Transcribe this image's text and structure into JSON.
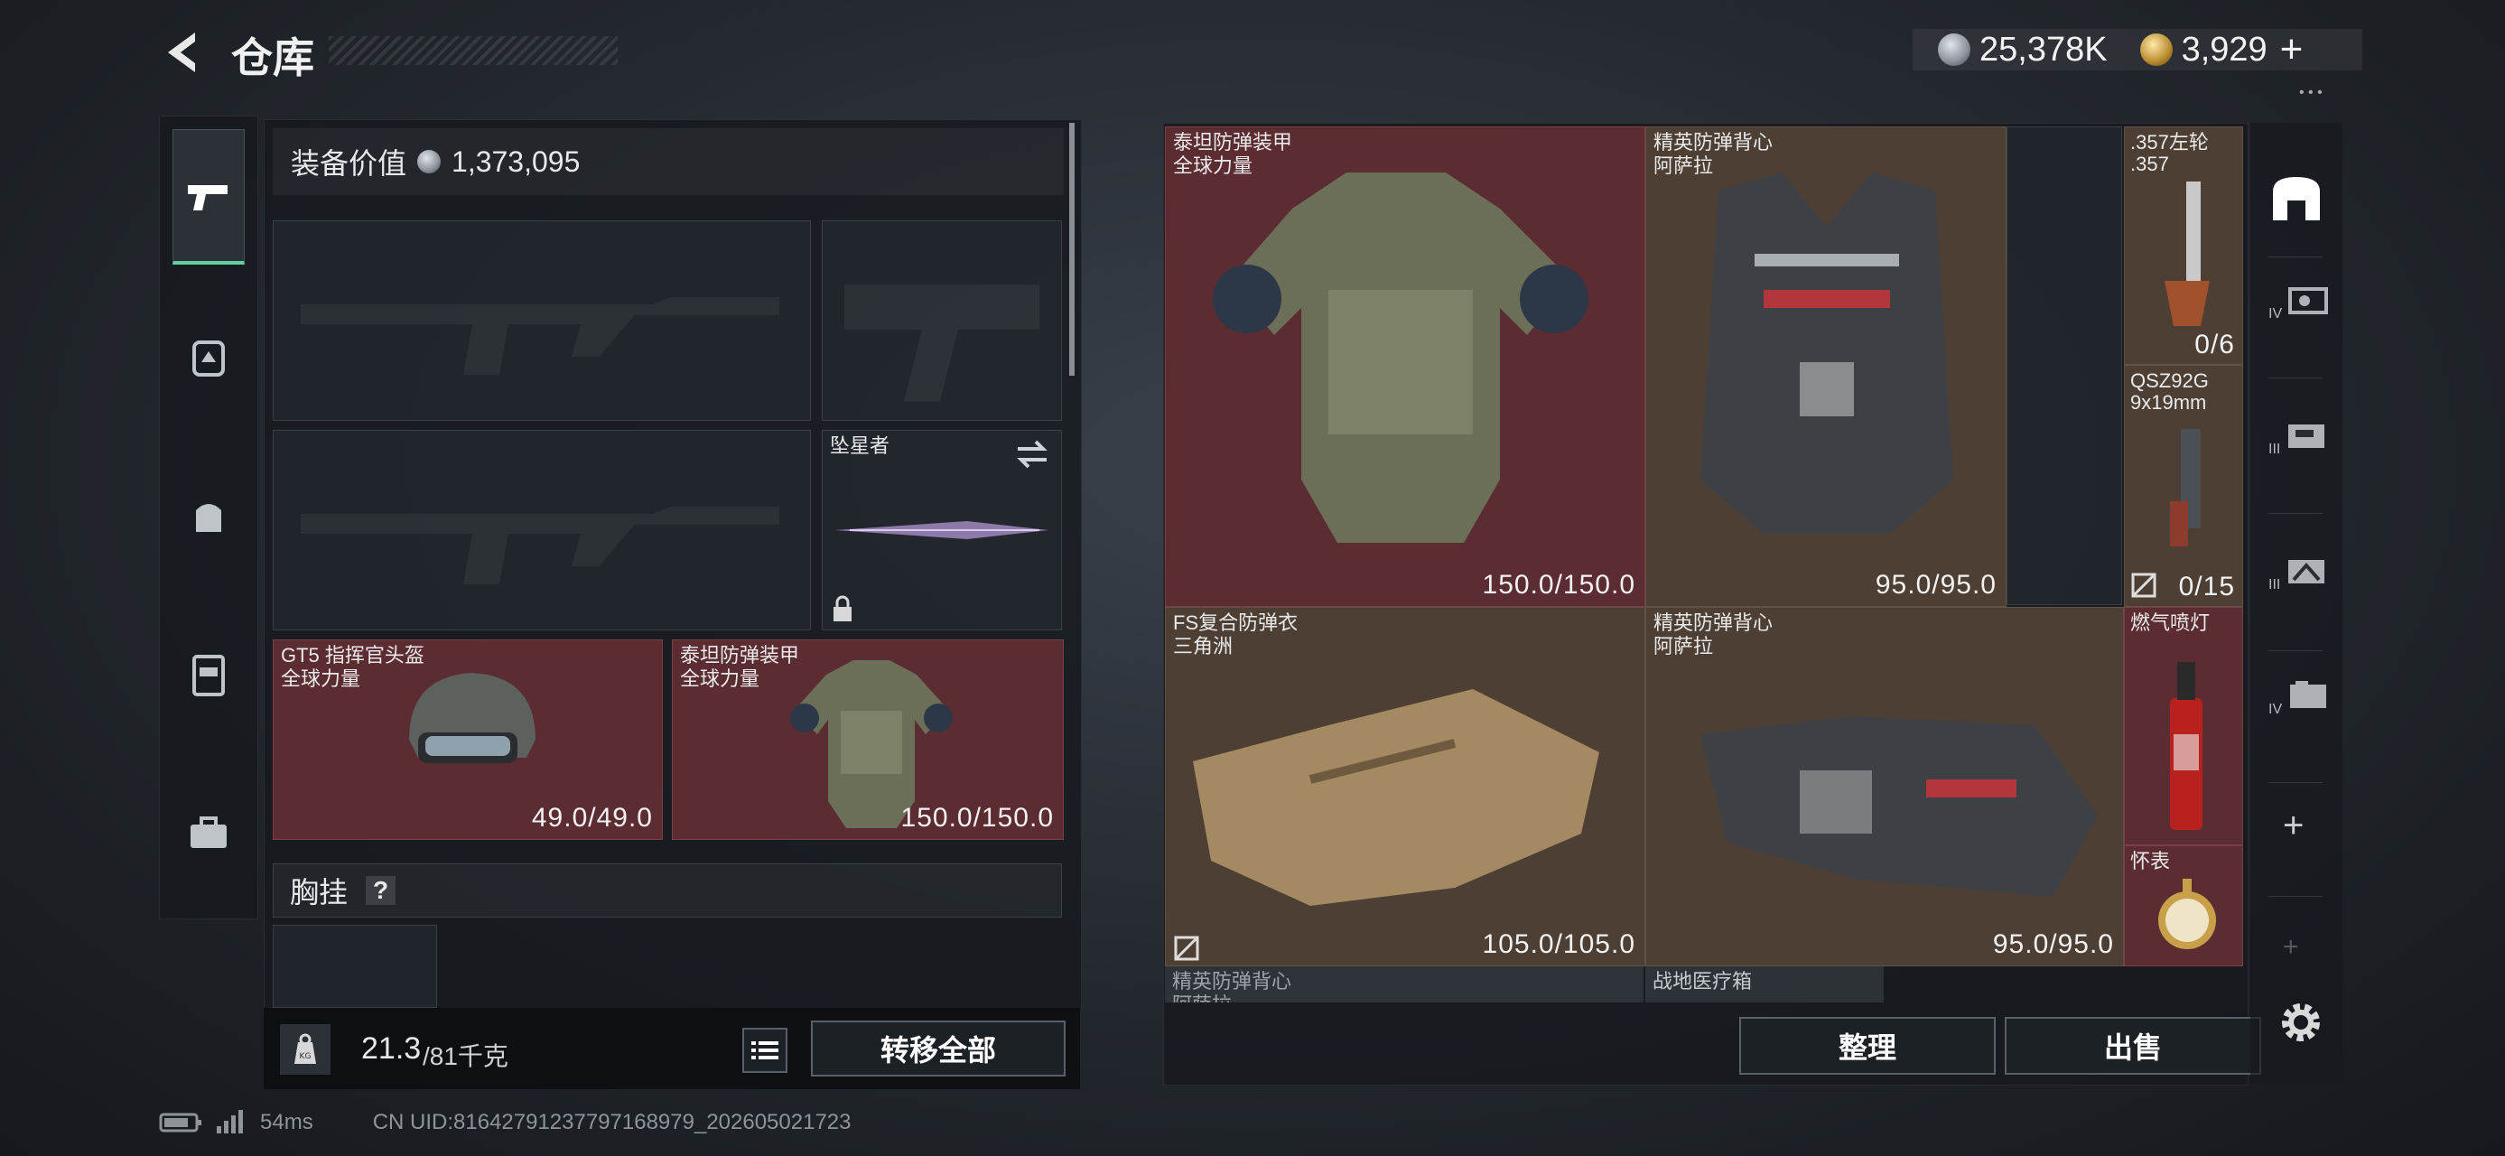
{
  "header": {
    "title": "仓库",
    "currency_silver": "25,378K",
    "currency_gold": "3,929"
  },
  "equipment": {
    "value_label": "装备价值",
    "value": "1,373,095"
  },
  "slots": {
    "melee_name": "坠星者",
    "helmet": {
      "name": "GT5 指挥官头盔",
      "brand": "全球力量",
      "durability": "49.0/49.0"
    },
    "armor": {
      "name": "泰坦防弹装甲",
      "brand": "全球力量",
      "durability": "150.0/150.0"
    }
  },
  "chest_rig": {
    "label": "胸挂",
    "help": "?"
  },
  "weight": {
    "current": "21.3",
    "max_unit": "/81千克",
    "icon_text": "KG"
  },
  "buttons": {
    "transfer_all": "转移全部",
    "organize": "整理",
    "sell": "出售"
  },
  "stash": {
    "items": [
      {
        "name": "泰坦防弹装甲",
        "brand": "全球力量",
        "durability": "150.0/150.0"
      },
      {
        "name": "精英防弹背心",
        "brand": "阿萨拉",
        "durability": "95.0/95.0"
      },
      {
        "name": "FS复合防弹衣",
        "brand": "三角洲",
        "durability": "105.0/105.0"
      },
      {
        "name": "精英防弹背心",
        "brand": "阿萨拉",
        "durability": "95.0/95.0"
      },
      {
        "name": "精英防弹背心",
        "brand": "阿萨拉"
      },
      {
        "name": "战地医疗箱"
      }
    ],
    "small_items": [
      {
        "name": ".357左轮",
        "sub": ".357",
        "count": "0/6"
      },
      {
        "name": "QSZ92G",
        "sub": "9x19mm",
        "count": "0/15"
      },
      {
        "name": "燃气喷灯"
      },
      {
        "name": "怀表"
      }
    ]
  },
  "tabs_right": [
    "IV",
    "III",
    "III",
    "IV"
  ],
  "status": {
    "ping": "54ms",
    "uid": "CN UID:8164279123779716897​9_202605021723"
  }
}
